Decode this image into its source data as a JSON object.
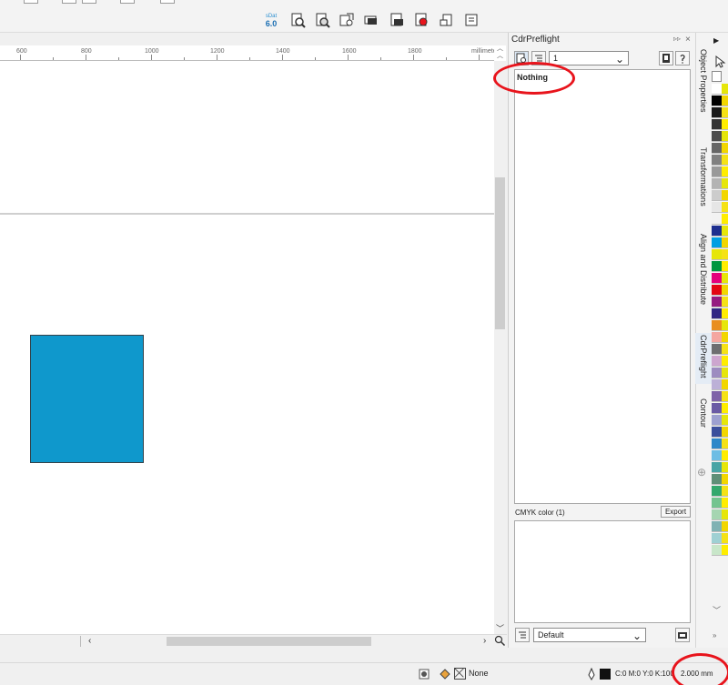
{
  "toolbar": {
    "icons": [
      "sdat-logo-icon",
      "preflight-icon-1",
      "preflight-icon-2",
      "preflight-icon-3",
      "preflight-icon-4",
      "preflight-icon-5",
      "preflight-icon-6",
      "preflight-icon-7",
      "preflight-icon-8"
    ],
    "logo_top": "sDat",
    "logo_bottom": "6.0"
  },
  "ruler": {
    "labels": [
      "600",
      "800",
      "1000",
      "1200",
      "1400",
      "1600",
      "1800"
    ],
    "unit": "millimeters"
  },
  "docker": {
    "title": "CdrPreflight",
    "page_select": "1",
    "issues_text": "Nothing",
    "color_section_label": "CMYK color (1)",
    "export_label": "Export",
    "profile_select": "Default"
  },
  "tabs": [
    {
      "label": "Object Properties",
      "active": false
    },
    {
      "label": "Transformations",
      "active": false
    },
    {
      "label": "Align and Distribute",
      "active": false
    },
    {
      "label": "CdrPreflight",
      "active": true
    },
    {
      "label": "Contour",
      "active": false
    }
  ],
  "status": {
    "fill_label": "None",
    "color_values": "C:0 M:0 Y:0 K:100",
    "outline_width": "2.000 mm"
  },
  "colors": {
    "shape_fill": "#0f98cc",
    "highlight": "#e8141c",
    "palette": [
      "#ffffff",
      "#000000",
      "#1a1a1a",
      "#333333",
      "#4d4d4d",
      "#666666",
      "#808080",
      "#999999",
      "#b3b3b3",
      "#cccccc",
      "#e6e6e6",
      "#f2f2f2",
      "#1d2f8f",
      "#009fe3",
      "#e6e60a",
      "#009640",
      "#e4007c",
      "#e30613",
      "#951b81",
      "#312783",
      "#e98e1f",
      "#f4a6a0",
      "#6d6e70",
      "#cda6cf",
      "#9d8cc0",
      "#bcb0d7",
      "#7f62a8",
      "#6a5aa5",
      "#9da0d0",
      "#3b4f9c",
      "#2e88c9",
      "#6dbde4",
      "#48a4a5",
      "#5f8f77",
      "#33a86c",
      "#73c48f",
      "#a5d5b1",
      "#7fb2b3",
      "#9fd0d3",
      "#c8e6c9"
    ]
  }
}
